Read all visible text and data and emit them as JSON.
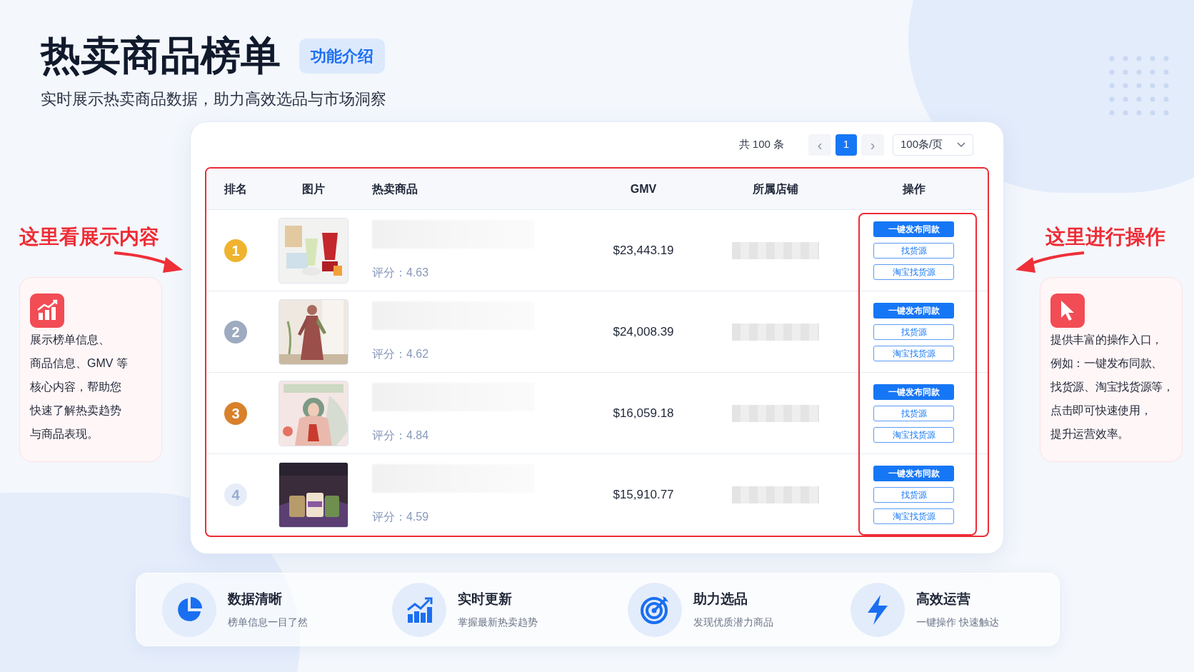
{
  "header": {
    "title": "热卖商品榜单",
    "badge": "功能介绍",
    "subtitle": "实时展示热卖商品数据，助力高效选品与市场洞察"
  },
  "callouts": [
    {
      "heading": "这里看展示内容",
      "kind": "chart",
      "lines": [
        "展示榜单信息、",
        "商品信息、GMV 等",
        "核心内容，帮助您",
        "快速了解热卖趋势",
        "与商品表现。"
      ]
    },
    {
      "heading": "这里进行操作",
      "kind": "cursor",
      "lines": [
        "提供丰富的操作入口，",
        "例如：一键发布同款、",
        "找货源、淘宝找货源等，",
        "点击即可快速使用，",
        "提升运营效率。"
      ]
    }
  ],
  "table": {
    "pagination": {
      "total": "共 100 条",
      "prev": "‹",
      "pages": [
        {
          "label": "1",
          "selected": true
        }
      ],
      "next": "›",
      "page_size": "100条/页"
    },
    "columns": [
      "排名",
      "图片",
      "热卖商品",
      "GMV",
      "所属店铺",
      "操作"
    ],
    "rows": [
      {
        "rank": "1",
        "color": "#efb32f",
        "rating": "评分：4.63",
        "gmv": "$23,443.19",
        "actions": [
          {
            "label": "一键发布同款",
            "kind": "primary"
          },
          {
            "label": "找货源",
            "kind": "outline"
          },
          {
            "label": "淘宝找货源",
            "kind": "outline"
          }
        ]
      },
      {
        "rank": "2",
        "color": "#9eaac0",
        "rating": "评分：4.62",
        "gmv": "$24,008.39",
        "actions": [
          {
            "label": "一键发布同款",
            "kind": "primary"
          },
          {
            "label": "找货源",
            "kind": "outline"
          },
          {
            "label": "淘宝找货源",
            "kind": "outline"
          }
        ]
      },
      {
        "rank": "3",
        "color": "#d9802a",
        "rating": "评分：4.84",
        "gmv": "$16,059.18",
        "actions": [
          {
            "label": "一键发布同款",
            "kind": "primary"
          },
          {
            "label": "找货源",
            "kind": "outline"
          },
          {
            "label": "淘宝找货源",
            "kind": "outline"
          }
        ]
      },
      {
        "rank": "4",
        "color": "#e6edf9",
        "rating": "评分：4.59",
        "gmv": "$15,910.77",
        "actions": [
          {
            "label": "一键发布同款",
            "kind": "primary"
          },
          {
            "label": "找货源",
            "kind": "outline"
          },
          {
            "label": "淘宝找货源",
            "kind": "outline"
          }
        ]
      }
    ]
  },
  "features": [
    {
      "kind": "pie",
      "title": "数据清晰",
      "subtitle": "榜单信息一目了然"
    },
    {
      "kind": "growth",
      "title": "实时更新",
      "subtitle": "掌握最新热卖趋势"
    },
    {
      "kind": "target",
      "title": "助力选品",
      "subtitle": "发现优质潜力商品"
    },
    {
      "kind": "bolt",
      "title": "高效运营",
      "subtitle": "一键操作 快速触达"
    }
  ]
}
